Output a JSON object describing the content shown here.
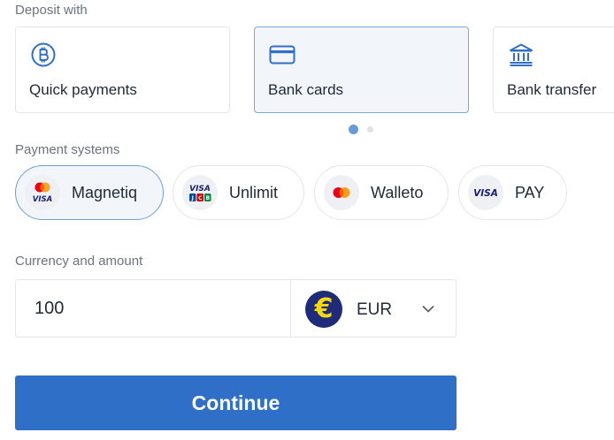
{
  "deposit": {
    "label": "Deposit with",
    "methods": [
      {
        "label": "Quick payments",
        "icon": "bitcoin-icon",
        "selected": false
      },
      {
        "label": "Bank cards",
        "icon": "credit-card-icon",
        "selected": true
      },
      {
        "label": "Bank transfer",
        "icon": "bank-icon",
        "selected": false
      }
    ],
    "carousel": {
      "page": 1,
      "pages": 2
    }
  },
  "payment_systems": {
    "label": "Payment systems",
    "items": [
      {
        "label": "Magnetiq",
        "logo": "mastercard-visa-logo",
        "selected": true
      },
      {
        "label": "Unlimit",
        "logo": "visa-jcb-logo",
        "selected": false
      },
      {
        "label": "Walleto",
        "logo": "mastercard-logo",
        "selected": false
      },
      {
        "label": "PAY",
        "logo": "visa-logo",
        "selected": false
      }
    ]
  },
  "amount": {
    "label": "Currency and amount",
    "value": "100",
    "currency": "EUR",
    "currency_symbol": "€",
    "currency_icon": "euro-icon"
  },
  "continue_label": "Continue",
  "colors": {
    "accent": "#2f6fc8",
    "selected_bg": "#f2f6fb",
    "selected_border": "#7aa7dc",
    "euro_bg": "#1d2b7a",
    "euro_fg": "#f5d90a"
  }
}
